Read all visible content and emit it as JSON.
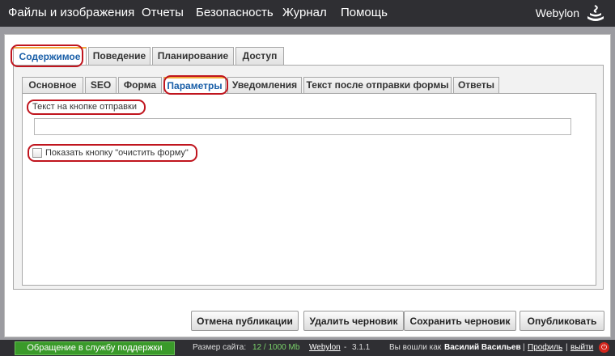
{
  "nav": {
    "items": [
      "Файлы и изображения",
      "Отчеты",
      "Безопасность",
      "Журнал",
      "Помощь"
    ],
    "brand": "Webylon"
  },
  "tabs": {
    "primary": [
      "Содержимое",
      "Поведение",
      "Планирование",
      "Доступ"
    ],
    "primary_active": "Содержимое",
    "secondary": [
      "Основное",
      "SEO",
      "Форма",
      "Параметры",
      "Уведомления",
      "Текст после отправки формы",
      "Ответы"
    ],
    "secondary_active": "Параметры"
  },
  "form": {
    "submit_text_label": "Текст на кнопке отправки",
    "submit_text_value": "",
    "clear_checkbox_label": "Показать кнопку \"очистить форму\"",
    "clear_checkbox_checked": false
  },
  "actions": {
    "unpublish": "Отмена публикации",
    "delete_draft": "Удалить черновик",
    "save_draft": "Сохранить черновик",
    "publish": "Опубликовать"
  },
  "footer": {
    "support": "Обращение в службу поддержки",
    "size_label": "Размер сайта:",
    "size_value": "12 / 1000 Mb",
    "product": "Webylon",
    "version": "3.1.1",
    "logged_in": "Вы вошли как",
    "user": "Василий Васильев",
    "profile": "Профиль",
    "logout": "выйти"
  },
  "colors": {
    "topbar": "#2f2f33",
    "highlight": "#c0151e",
    "tab_accent": "#f2a93b",
    "support_green": "#3a9a2a"
  }
}
